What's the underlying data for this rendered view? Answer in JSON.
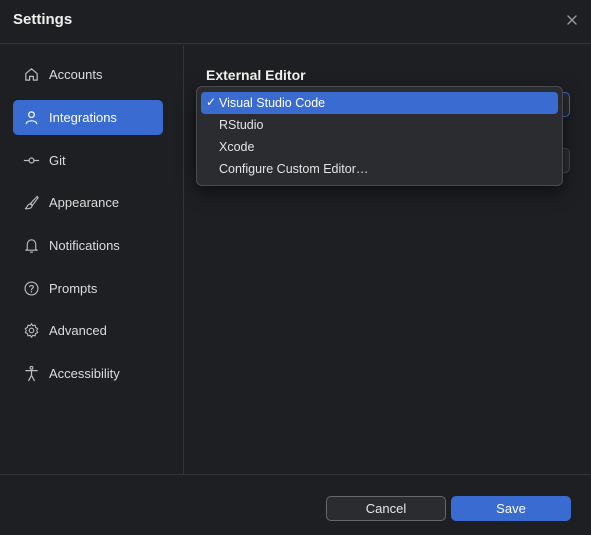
{
  "window": {
    "title": "Settings"
  },
  "sidebar": {
    "items": [
      {
        "label": "Accounts",
        "icon": "home-icon",
        "active": false
      },
      {
        "label": "Integrations",
        "icon": "person-icon",
        "active": true
      },
      {
        "label": "Git",
        "icon": "git-commit-icon",
        "active": false
      },
      {
        "label": "Appearance",
        "icon": "brush-icon",
        "active": false
      },
      {
        "label": "Notifications",
        "icon": "bell-icon",
        "active": false
      },
      {
        "label": "Prompts",
        "icon": "question-circle-icon",
        "active": false
      },
      {
        "label": "Advanced",
        "icon": "gear-icon",
        "active": false
      },
      {
        "label": "Accessibility",
        "icon": "accessibility-icon",
        "active": false
      }
    ]
  },
  "content": {
    "section_title": "External Editor",
    "dropdown": {
      "selected": "Visual Studio Code",
      "check": "✓",
      "options": [
        "Visual Studio Code",
        "RStudio",
        "Xcode",
        "Configure Custom Editor…"
      ]
    }
  },
  "footer": {
    "cancel_label": "Cancel",
    "save_label": "Save"
  },
  "colors": {
    "accent": "#3a6bd1",
    "background": "#1e1f22",
    "surface": "#2b2c30",
    "border": "#34353a"
  }
}
